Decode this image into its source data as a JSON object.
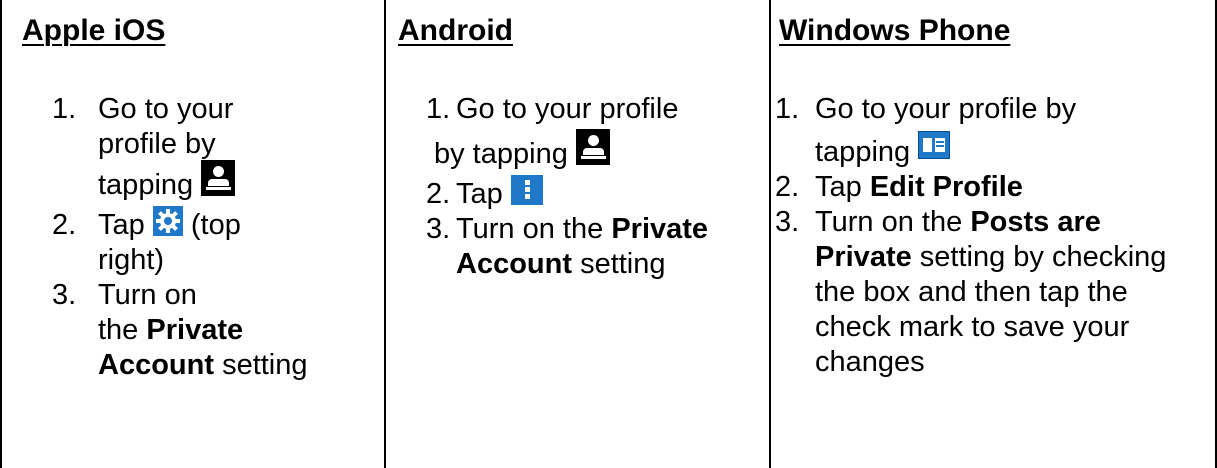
{
  "columns": [
    {
      "header": "Apple iOS",
      "steps": [
        {
          "num": "1.",
          "parts": [
            "Go to your",
            "profile by",
            "tapping"
          ]
        },
        {
          "num": "2.",
          "parts": [
            "Tap",
            "(top",
            "right)"
          ]
        },
        {
          "num": "3.",
          "parts": [
            "Turn on",
            "the",
            "Private",
            "Account",
            "setting"
          ]
        }
      ]
    },
    {
      "header": "Android",
      "steps": [
        {
          "num": "1.",
          "parts": [
            "Go to your profile",
            "by tapping"
          ]
        },
        {
          "num": "2.",
          "parts": [
            "Tap"
          ]
        },
        {
          "num": "3.",
          "parts": [
            "Turn on the",
            "Private",
            "Account",
            "setting"
          ]
        }
      ]
    },
    {
      "header": "Windows Phone",
      "steps": [
        {
          "num": "1.",
          "parts": [
            "Go to your profile by",
            "tapping"
          ]
        },
        {
          "num": "2.",
          "parts": [
            "Tap",
            "Edit Profile"
          ]
        },
        {
          "num": "3.",
          "parts": [
            "Turn on the",
            "Posts are",
            "Private",
            "setting by checking",
            "the box and then tap the",
            "check mark to save your",
            "changes"
          ]
        }
      ]
    }
  ],
  "icons": {
    "profile": "person-icon",
    "settings": "gear-icon",
    "menu": "more-vertical-icon",
    "windows_profile": "profile-card-icon",
    "accent": "#1f78c8"
  }
}
